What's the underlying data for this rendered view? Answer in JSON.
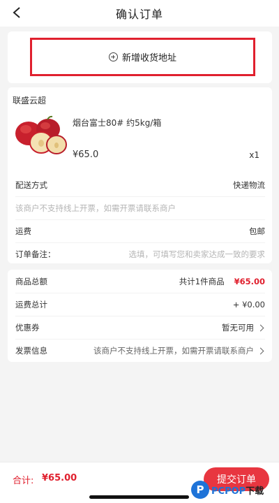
{
  "header": {
    "title": "确认订单"
  },
  "address": {
    "add_label": "新增收货地址"
  },
  "shop": {
    "name": "联盛云超"
  },
  "product": {
    "name": "烟台富士80# 约5kg/箱",
    "price": "¥65.0",
    "qty": "x1",
    "image_icon": "apple-image"
  },
  "delivery": {
    "method_label": "配送方式",
    "method_value": "快递物流",
    "invoice_notice": "该商户不支持线上开票，如需开票请联系商户",
    "freight_label": "运费",
    "freight_value": "包邮",
    "remark_label": "订单备注：",
    "remark_placeholder": "选填，可填写您和卖家达成一致的要求"
  },
  "summary": {
    "goods_total_label": "商品总额",
    "goods_count": "共计1件商品",
    "goods_total_value": "¥65.00",
    "freight_total_label": "运费总计",
    "freight_total_value": "+ ¥0.00",
    "coupon_label": "优惠券",
    "coupon_value": "暂无可用",
    "invoice_label": "发票信息",
    "invoice_value": "该商户不支持线上开票，如需开票请联系商户"
  },
  "footer": {
    "total_label": "合计:",
    "total_value": "¥65.00",
    "submit_label": "提交订单"
  },
  "watermark": {
    "badge": "P",
    "brand": "PCPOP",
    "suffix": "下载"
  },
  "colors": {
    "accent": "#e0202e",
    "submit_bg": "#e83640",
    "background": "#f4f4f4"
  }
}
